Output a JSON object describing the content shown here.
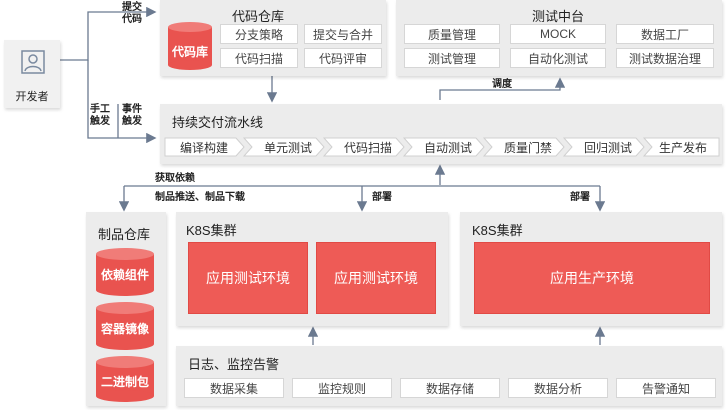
{
  "developer": {
    "label": "开发者"
  },
  "code_repo": {
    "title": "代码仓库",
    "db_label": "代码库",
    "items": [
      "分支策略",
      "提交与合并",
      "代码扫描",
      "代码评审"
    ]
  },
  "test_center": {
    "title": "测试中台",
    "items": [
      "质量管理",
      "MOCK",
      "数据工厂",
      "测试管理",
      "自动化测试",
      "测试数据治理"
    ]
  },
  "pipeline": {
    "title": "持续交付流水线",
    "stages": [
      "编译构建",
      "单元测试",
      "代码扫描",
      "自动测试",
      "质量门禁",
      "回归测试",
      "生产发布"
    ]
  },
  "artifact_repo": {
    "title": "制品仓库",
    "items": [
      "依赖组件",
      "容器镜像",
      "二进制包"
    ]
  },
  "k8s_test": {
    "title": "K8S集群",
    "envs": [
      "应用测试环境",
      "应用测试环境"
    ]
  },
  "k8s_prod": {
    "title": "K8S集群",
    "env": "应用生产环境"
  },
  "monitoring": {
    "title": "日志、监控告警",
    "items": [
      "数据采集",
      "监控规则",
      "数据存储",
      "数据分析",
      "告警通知"
    ]
  },
  "edge_labels": {
    "commit_code": "提交\n代码",
    "manual_trigger": "手工\n触发",
    "event_trigger": "事件\n触发",
    "schedule": "调度",
    "fetch_deps": "获取依赖",
    "push_download": "制品推送、制品下载",
    "deploy_test": "部署",
    "deploy_prod": "部署"
  },
  "colors": {
    "accent": "#ee5b56",
    "panel": "#ececec",
    "arrow": "#6b7a90"
  }
}
